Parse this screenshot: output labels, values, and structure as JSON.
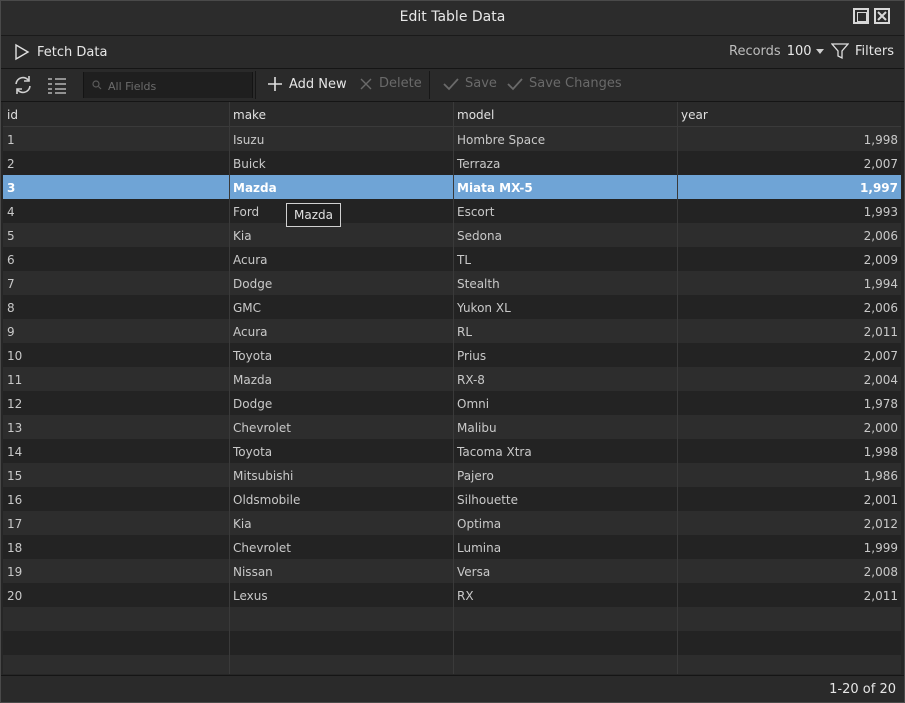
{
  "window": {
    "title": "Edit Table Data"
  },
  "toolbar": {
    "fetch_label": "Fetch Data",
    "records_label": "Records",
    "records_value": "100",
    "filters_label": "Filters",
    "search_placeholder": "All Fields",
    "add_new_label": "Add New",
    "delete_label": "Delete",
    "save_label": "Save",
    "save_changes_label": "Save Changes"
  },
  "table": {
    "columns": [
      "id",
      "make",
      "model",
      "year"
    ],
    "selected_row": 2,
    "rows": [
      {
        "id": "1",
        "make": "Isuzu",
        "model": "Hombre Space",
        "year": "1,998"
      },
      {
        "id": "2",
        "make": "Buick",
        "model": "Terraza",
        "year": "2,007"
      },
      {
        "id": "3",
        "make": "Mazda",
        "model": "Miata MX-5",
        "year": "1,997"
      },
      {
        "id": "4",
        "make": "Ford",
        "model": "Escort",
        "year": "1,993"
      },
      {
        "id": "5",
        "make": "Kia",
        "model": "Sedona",
        "year": "2,006"
      },
      {
        "id": "6",
        "make": "Acura",
        "model": "TL",
        "year": "2,009"
      },
      {
        "id": "7",
        "make": "Dodge",
        "model": "Stealth",
        "year": "1,994"
      },
      {
        "id": "8",
        "make": "GMC",
        "model": "Yukon XL",
        "year": "2,006"
      },
      {
        "id": "9",
        "make": "Acura",
        "model": "RL",
        "year": "2,011"
      },
      {
        "id": "10",
        "make": "Toyota",
        "model": "Prius",
        "year": "2,007"
      },
      {
        "id": "11",
        "make": "Mazda",
        "model": "RX-8",
        "year": "2,004"
      },
      {
        "id": "12",
        "make": "Dodge",
        "model": "Omni",
        "year": "1,978"
      },
      {
        "id": "13",
        "make": "Chevrolet",
        "model": "Malibu",
        "year": "2,000"
      },
      {
        "id": "14",
        "make": "Toyota",
        "model": "Tacoma Xtra",
        "year": "1,998"
      },
      {
        "id": "15",
        "make": "Mitsubishi",
        "model": "Pajero",
        "year": "1,986"
      },
      {
        "id": "16",
        "make": "Oldsmobile",
        "model": "Silhouette",
        "year": "2,001"
      },
      {
        "id": "17",
        "make": "Kia",
        "model": "Optima",
        "year": "2,012"
      },
      {
        "id": "18",
        "make": "Chevrolet",
        "model": "Lumina",
        "year": "1,999"
      },
      {
        "id": "19",
        "make": "Nissan",
        "model": "Versa",
        "year": "2,008"
      },
      {
        "id": "20",
        "make": "Lexus",
        "model": "RX",
        "year": "2,011"
      }
    ]
  },
  "tooltip": {
    "text": "Mazda"
  },
  "status": {
    "range": "1-20 of 20"
  },
  "colors": {
    "selected_row": "#6fa4d6",
    "background": "#222222",
    "text": "#c9c9c9"
  },
  "icons": {
    "fetch": "play-icon",
    "filters": "funnel-icon",
    "refresh": "refresh-icon",
    "columns": "columns-list-icon",
    "search": "search-icon",
    "add": "plus-icon",
    "delete": "x-icon",
    "save": "check-icon",
    "save_changes": "check-icon"
  }
}
